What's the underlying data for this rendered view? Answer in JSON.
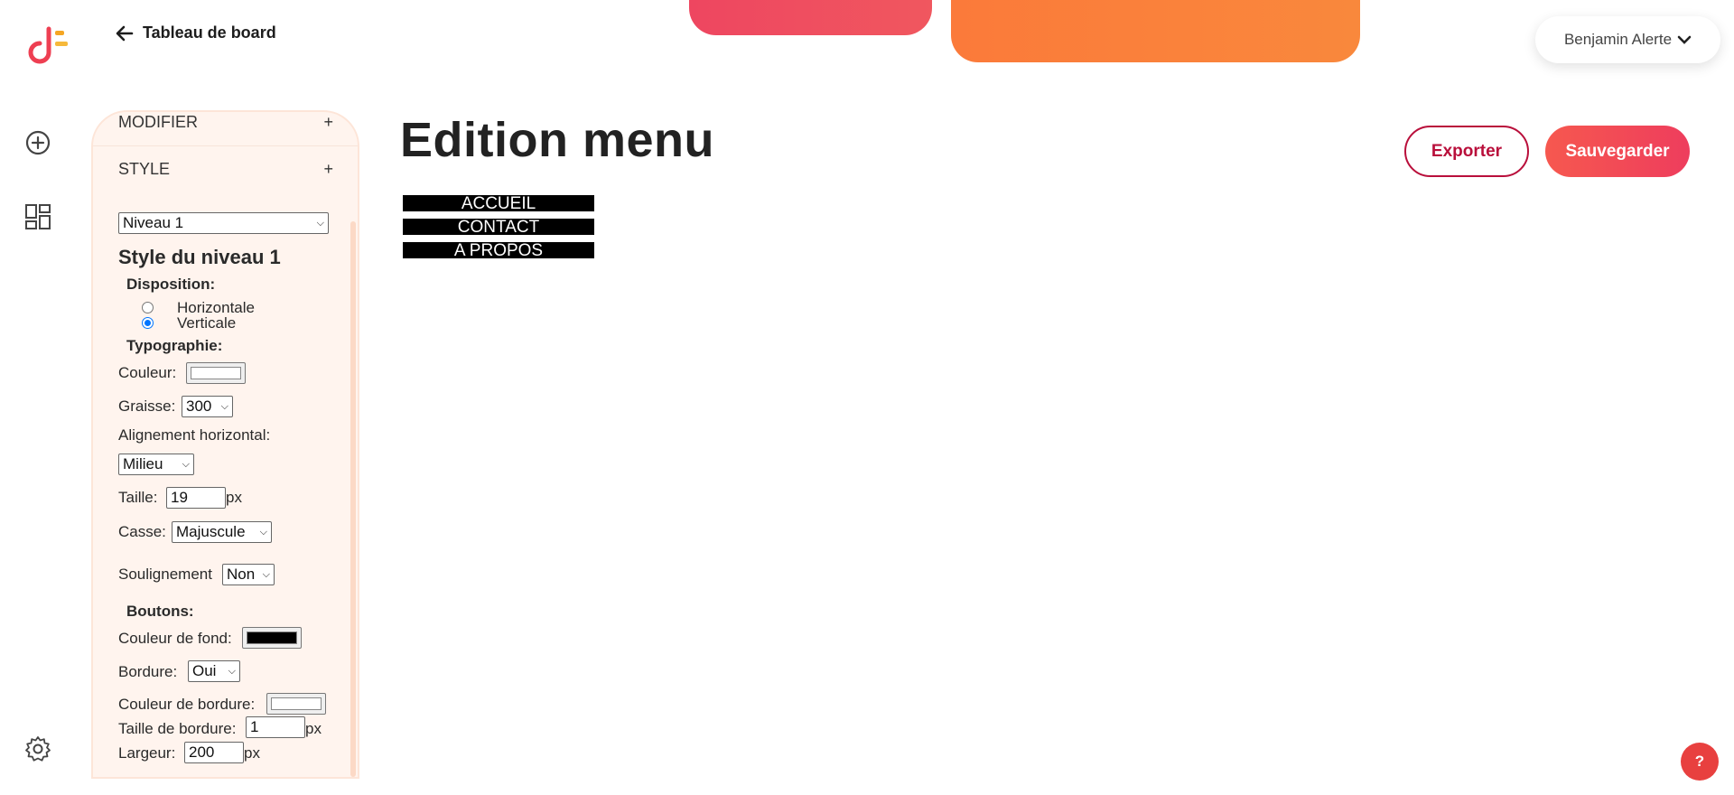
{
  "brand": {
    "logo_icon": "logo-icon",
    "accent": "#ee4660",
    "orange": "#fb7a3a"
  },
  "header": {
    "back_label": "Tableau de board",
    "user_name": "Benjamin Alerte"
  },
  "rail": {
    "icons": [
      "add-circle-icon",
      "dashboard-icon",
      "settings-icon"
    ]
  },
  "panel": {
    "sections": {
      "modifier": "MODIFIER",
      "style": "STYLE",
      "toggle": "+"
    },
    "level_select": "Niveau 1",
    "level_title": "Style du niveau 1",
    "disposition": {
      "label": "Disposition:",
      "horizontal": "Horizontale",
      "vertical": "Verticale",
      "selected": "Verticale"
    },
    "typographie": {
      "label": "Typographie:",
      "couleur_label": "Couleur:",
      "couleur_value": "#ffffff",
      "graisse_label": "Graisse:",
      "graisse_value": "300",
      "alignement_label": "Alignement horizontal:",
      "alignement_value": "Milieu",
      "taille_label": "Taille:",
      "taille_value": "19",
      "taille_unit": "px",
      "casse_label": "Casse:",
      "casse_value": "Majuscule",
      "soulignement_label": "Soulignement",
      "soulignement_value": "Non"
    },
    "boutons": {
      "label": "Boutons:",
      "fond_label": "Couleur de fond:",
      "fond_value": "#000000",
      "bordure_label": "Bordure:",
      "bordure_value": "Oui",
      "couleur_bordure_label": "Couleur de bordure:",
      "couleur_bordure_value": "#ffffff",
      "taille_bordure_label": "Taille de bordure:",
      "taille_bordure_value": "1",
      "taille_bordure_unit": "px",
      "largeur_label": "Largeur:",
      "largeur_value": "200",
      "largeur_unit": "px"
    }
  },
  "main": {
    "title": "Edition menu",
    "export_label": "Exporter",
    "save_label": "Sauvegarder",
    "menu_items": [
      "Accueil",
      "Contact",
      "A propos"
    ]
  },
  "help_label": "?"
}
